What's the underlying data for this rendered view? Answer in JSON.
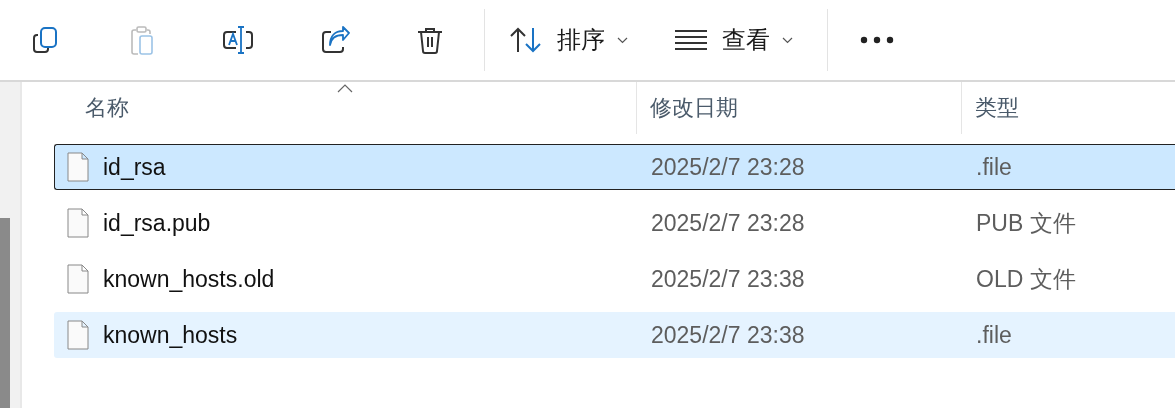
{
  "toolbar": {
    "buttons": [
      {
        "kind": "copy",
        "disabled": false
      },
      {
        "kind": "paste",
        "disabled": true
      },
      {
        "kind": "rename",
        "disabled": false
      },
      {
        "kind": "share",
        "disabled": false
      },
      {
        "kind": "delete",
        "disabled": false
      }
    ],
    "sort": {
      "label": "排序"
    },
    "view": {
      "label": "查看"
    }
  },
  "columns": [
    {
      "label": "名称",
      "sorted": true
    },
    {
      "label": "修改日期",
      "sorted": false
    },
    {
      "label": "类型",
      "sorted": false
    }
  ],
  "rows": [
    {
      "name": "id_rsa",
      "modified": "2025/2/7 23:28",
      "type": ".file",
      "selected": true,
      "hovered": false
    },
    {
      "name": "id_rsa.pub",
      "modified": "2025/2/7 23:28",
      "type": "PUB 文件",
      "selected": false,
      "hovered": false
    },
    {
      "name": "known_hosts.old",
      "modified": "2025/2/7 23:38",
      "type": "OLD 文件",
      "selected": false,
      "hovered": false
    },
    {
      "name": "known_hosts",
      "modified": "2025/2/7 23:38",
      "type": ".file",
      "selected": false,
      "hovered": true
    }
  ]
}
